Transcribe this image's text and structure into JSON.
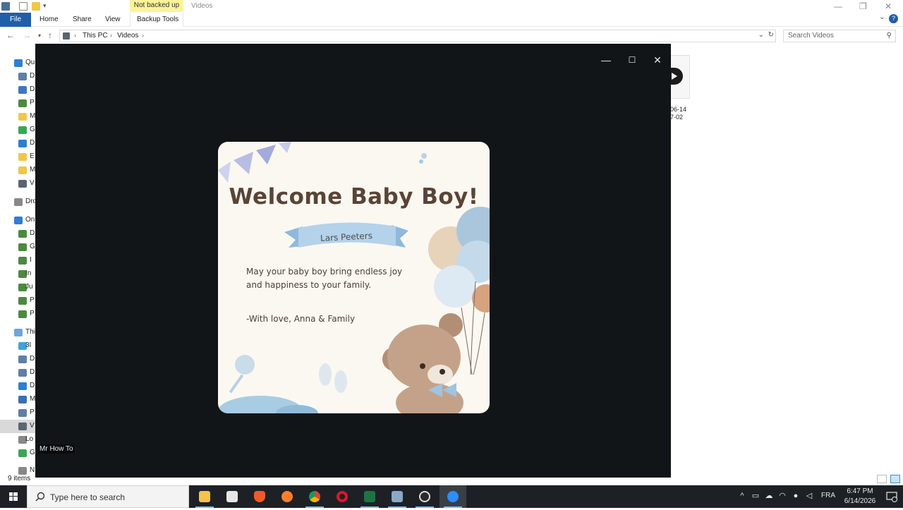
{
  "explorer": {
    "context_tab_label": "Not backed up",
    "context_title": "Videos",
    "ribbon": {
      "file": "File",
      "home": "Home",
      "share": "Share",
      "view": "View",
      "backup_tools": "Backup Tools"
    },
    "breadcrumb": {
      "this_pc": "This PC",
      "videos": "Videos"
    },
    "search_placeholder": "Search Videos",
    "nav_items": [
      "Qu",
      "D",
      "D",
      "P",
      "M",
      "G",
      "D",
      "E",
      "M",
      "V",
      "Dro",
      "On",
      "D",
      "G",
      "I",
      "In",
      "Ju",
      "P",
      "P",
      "Thi",
      "3I",
      "D",
      "D",
      "D",
      "M",
      "P",
      "V",
      "Lo",
      "G",
      "N"
    ],
    "file_name": "06-14\n7-02",
    "status_items": "9 items"
  },
  "viewer": {
    "watermark": "Mr How To",
    "card": {
      "title": "Welcome Baby Boy!",
      "name": "Lars Peeters",
      "message_line1": "May your baby boy bring endless joy",
      "message_line2": "and happiness to your family.",
      "signature": "-With love, Anna & Family"
    }
  },
  "taskbar": {
    "search_placeholder": "Type here to search",
    "language": "FRA",
    "time": "6:47 PM",
    "date": "6/14/2026",
    "apps": [
      "file-explorer",
      "microsoft-store",
      "brave",
      "firefox",
      "chrome",
      "opera",
      "excel",
      "calculator",
      "obs",
      "zoom"
    ]
  },
  "colors": {
    "ctx_tab": "#fbf39a",
    "file_tab": "#1f5fa9",
    "viewer_bg": "#121518",
    "card_bg": "#fbf8f1",
    "title_brown": "#5a4437",
    "ribbon_blue": "#a9cbe3",
    "taskbar": "#1d2126"
  }
}
